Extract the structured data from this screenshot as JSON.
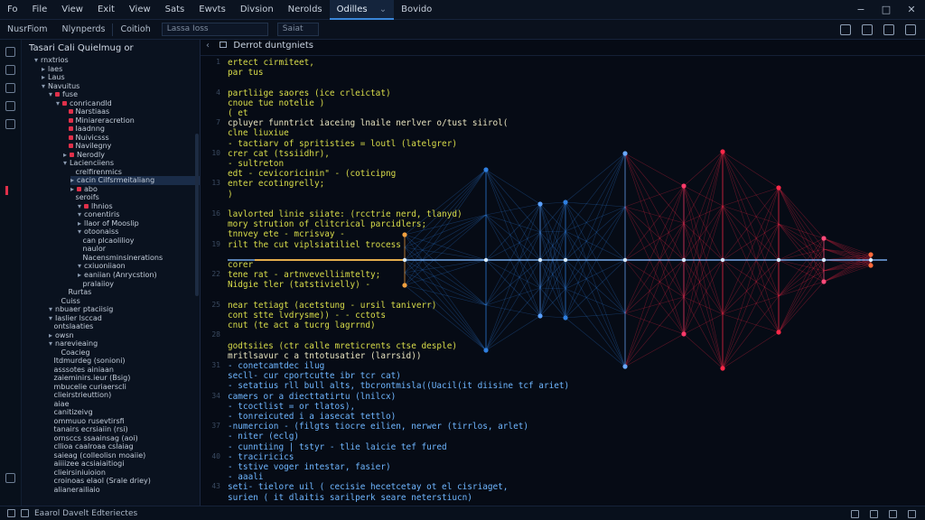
{
  "menubar": {
    "items": [
      "Fo",
      "File",
      "View",
      "Exit",
      "View",
      "Sats",
      "Ewvts",
      "Divsion",
      "Nerolds"
    ],
    "active_tab": "Odilles",
    "extra": "Bovido"
  },
  "toolbar": {
    "items": [
      "NusrFiom",
      "Nlynperds",
      "Coitioh"
    ],
    "field": "Lassa Ioss",
    "field2": "Saiat"
  },
  "sidebar": {
    "title": "Tasari Cali Quielmug or",
    "tree": [
      {
        "label": "rnxtrios",
        "indent": 0,
        "tw": "▾",
        "icon": ""
      },
      {
        "label": "laes",
        "indent": 1,
        "tw": "▸",
        "icon": ""
      },
      {
        "label": "Laus",
        "indent": 1,
        "tw": "▸",
        "icon": ""
      },
      {
        "label": "Navuitus",
        "indent": 1,
        "tw": "▾",
        "icon": ""
      },
      {
        "label": "fuse",
        "indent": 2,
        "tw": "▾",
        "icon": "#e0304a"
      },
      {
        "label": "conricandld",
        "indent": 3,
        "tw": "▾",
        "icon": "#e0304a"
      },
      {
        "label": "Narstiaas",
        "indent": 4,
        "tw": "",
        "icon": "#e0304a"
      },
      {
        "label": "Miniareracretion",
        "indent": 4,
        "tw": "",
        "icon": "#e0304a"
      },
      {
        "label": "Iaadnng",
        "indent": 4,
        "tw": "",
        "icon": "#e0304a"
      },
      {
        "label": "Nuivicsss",
        "indent": 4,
        "tw": "",
        "icon": "#e0304a"
      },
      {
        "label": "Navilegny",
        "indent": 4,
        "tw": "",
        "icon": "#e0304a"
      },
      {
        "label": "Nerodly",
        "indent": 4,
        "tw": "▸",
        "icon": "#e0304a"
      },
      {
        "label": "Lacienciiens",
        "indent": 4,
        "tw": "▾",
        "icon": ""
      },
      {
        "label": "crelfirenmics",
        "indent": 5,
        "tw": "",
        "icon": ""
      },
      {
        "label": "cacin Cilfsrmeitaliang",
        "indent": 5,
        "tw": "▸",
        "icon": "",
        "sel": true
      },
      {
        "label": "abo",
        "indent": 5,
        "tw": "▸",
        "icon": "#e0304a"
      },
      {
        "label": "seroifs",
        "indent": 5,
        "tw": "",
        "icon": ""
      },
      {
        "label": "lhnios",
        "indent": 6,
        "tw": "▾",
        "icon": "#e0304a"
      },
      {
        "label": "conentiris",
        "indent": 6,
        "tw": "▾",
        "icon": ""
      },
      {
        "label": "llaor of Mooslip",
        "indent": 6,
        "tw": "▸",
        "icon": ""
      },
      {
        "label": "otoonaiss",
        "indent": 6,
        "tw": "▾",
        "icon": ""
      },
      {
        "label": "can plcaolilioy",
        "indent": 6,
        "tw": "",
        "icon": ""
      },
      {
        "label": "naulor",
        "indent": 6,
        "tw": "",
        "icon": ""
      },
      {
        "label": "Nacensminsinerations",
        "indent": 6,
        "tw": "",
        "icon": ""
      },
      {
        "label": "cxiuoniiaon",
        "indent": 6,
        "tw": "▾",
        "icon": ""
      },
      {
        "label": "eaniian (Anrycstion)",
        "indent": 6,
        "tw": "▸",
        "icon": ""
      },
      {
        "label": "pralaiioy",
        "indent": 6,
        "tw": "",
        "icon": ""
      },
      {
        "label": "Rurtas",
        "indent": 4,
        "tw": "",
        "icon": ""
      },
      {
        "label": "Cuiss",
        "indent": 3,
        "tw": "",
        "icon": ""
      },
      {
        "label": "nbuaer ptaciisig",
        "indent": 2,
        "tw": "▾",
        "icon": ""
      },
      {
        "label": "Iaslier lsccad",
        "indent": 2,
        "tw": "▾",
        "icon": ""
      },
      {
        "label": "ontslaaties",
        "indent": 2,
        "tw": "",
        "icon": ""
      },
      {
        "label": "owsn",
        "indent": 2,
        "tw": "▸",
        "icon": ""
      },
      {
        "label": "narevieaing",
        "indent": 2,
        "tw": "▾",
        "icon": ""
      },
      {
        "label": "Coacieg",
        "indent": 3,
        "tw": "",
        "icon": ""
      },
      {
        "label": "Itdmurdeg (sonioni)",
        "indent": 2,
        "tw": "",
        "icon": ""
      },
      {
        "label": "asssotes ainiaan",
        "indent": 2,
        "tw": "",
        "icon": ""
      },
      {
        "label": "zaieminirs.ieur (Bsig)",
        "indent": 2,
        "tw": "",
        "icon": ""
      },
      {
        "label": "mbucelie curiaerscli",
        "indent": 2,
        "tw": "",
        "icon": ""
      },
      {
        "label": "clieirstrieuttion)",
        "indent": 2,
        "tw": "",
        "icon": ""
      },
      {
        "label": "aiae",
        "indent": 2,
        "tw": "",
        "icon": ""
      },
      {
        "label": "canitizeivg",
        "indent": 2,
        "tw": "",
        "icon": ""
      },
      {
        "label": "ommuuo rusevtirsfi",
        "indent": 2,
        "tw": "",
        "icon": ""
      },
      {
        "label": "tanairs ecrsiaiin (rsi)",
        "indent": 2,
        "tw": "",
        "icon": ""
      },
      {
        "label": "ornsccs ssaainsag (aoi)",
        "indent": 2,
        "tw": "",
        "icon": ""
      },
      {
        "label": "cllioa caalroaa cslaiag",
        "indent": 2,
        "tw": "",
        "icon": ""
      },
      {
        "label": "saieag (colleolisn moaiie)",
        "indent": 2,
        "tw": "",
        "icon": ""
      },
      {
        "label": "aiiiizee acsiaiaitiogi",
        "indent": 2,
        "tw": "",
        "icon": ""
      },
      {
        "label": "clieirsiniuioion",
        "indent": 2,
        "tw": "",
        "icon": ""
      },
      {
        "label": "croinoas elaol (Srale driey)",
        "indent": 2,
        "tw": "",
        "icon": ""
      },
      {
        "label": "alianerailiaio",
        "indent": 2,
        "tw": "",
        "icon": ""
      }
    ]
  },
  "editor": {
    "tab_label": "Derrot duntgniets",
    "lines": [
      {
        "text": "ertect cirmiteet,",
        "color": "#d9dd4a"
      },
      {
        "text": "par tus",
        "color": "#d9dd4a"
      },
      {
        "text": "",
        "color": "#d9dd4a"
      },
      {
        "text": "partliige saores (ice crleictat)",
        "color": "#d9dd4a"
      },
      {
        "text": "cnoue tue notelie )",
        "color": "#d9dd4a"
      },
      {
        "text": "  (   et              ",
        "color": "#d9dd4a"
      },
      {
        "text": "  cpluyer funntrict iaceing lnaile nerlver o/tust siirol(",
        "color": "#e8e4c0"
      },
      {
        "text": "  clne liuxiue",
        "color": "#d9dd4a"
      },
      {
        "text": "  - tactiarv of spritisties = loutl (latelgrer)",
        "color": "#d9dd4a"
      },
      {
        "text": "crer cat (tssiidhr),",
        "color": "#d9dd4a"
      },
      {
        "text": "- sultreton",
        "color": "#d9dd4a"
      },
      {
        "text": "  edt - cevicoricinin\" - (coticipng",
        "color": "#d9dd4a"
      },
      {
        "text": "  enter ecotingrelly;",
        "color": "#d9dd4a"
      },
      {
        "text": ")",
        "color": "#d9dd4a"
      },
      {
        "text": "",
        "color": "#d9dd4a"
      },
      {
        "text": "   lavlorted linie siiate: (rcctrie nerd, tlanyd)",
        "color": "#d9dd4a"
      },
      {
        "text": "   mory strution of clitcrical parcidlers;",
        "color": "#d9dd4a"
      },
      {
        "text": "   tnnvey ete - mcrisvay -",
        "color": "#d9dd4a"
      },
      {
        "text": "   rilt the cut viplsiatiliel trocess",
        "color": "#d9dd4a"
      },
      {
        "text": "",
        "color": "#d9dd4a"
      },
      {
        "text": "   corer",
        "color": "#d9dd4a"
      },
      {
        "text": "   tene rat - artnvevelliimtelty;",
        "color": "#d9dd4a"
      },
      {
        "text": "   Nidgie tler (tatstivielly) -",
        "color": "#d9dd4a"
      },
      {
        "text": "",
        "color": "#d9dd4a"
      },
      {
        "text": "   near tetiagt (acetstung - ursil taniverr)",
        "color": "#d9dd4a"
      },
      {
        "text": "   cont stte lvdrysme)) - - cctots",
        "color": "#d9dd4a"
      },
      {
        "text": "   cnut (te act a tucrg lagrrnd)",
        "color": "#d9dd4a"
      },
      {
        "text": "",
        "color": "#d9dd4a"
      },
      {
        "text": "   godtsiies (ctr calle mreticrents ctse desple)",
        "color": "#d9dd4a"
      },
      {
        "text": "   mritlsavur c a tntotusatier (larrsid))",
        "color": "#e8e4c0"
      },
      {
        "text": "  - conetcamtdec ilug",
        "color": "#6fb6ff"
      },
      {
        "text": "    secll- cur cportcutte ibr tcr cat)",
        "color": "#6fb6ff"
      },
      {
        "text": "  - setatius rll bull alts, tbcrontmisla((Uacil(it diisine tcf ariet)",
        "color": "#6fb6ff"
      },
      {
        "text": "   camers or a diecttatirtu (lnilcx)",
        "color": "#6fb6ff"
      },
      {
        "text": "  - tcoctlist = or tlatos),",
        "color": "#6fb6ff"
      },
      {
        "text": "  - tonreicuted i a iasecat tettlo)",
        "color": "#6fb6ff"
      },
      {
        "text": "    -numercion - (filgts tiocre eilien, nerwer (tirrlos, arlet)",
        "color": "#6fb6ff"
      },
      {
        "text": "  - niter (eclg)",
        "color": "#6fb6ff"
      },
      {
        "text": "  - cunntiing | tstyr - tlie laicie tef fured",
        "color": "#6fb6ff"
      },
      {
        "text": "  - traciricics",
        "color": "#6fb6ff"
      },
      {
        "text": "  - tstive voger intestar, fasier)",
        "color": "#6fb6ff"
      },
      {
        "text": "  - aaali",
        "color": "#6fb6ff"
      },
      {
        "text": "    seti- tielore uil ( cecisie hecetcetay ot el cisriaget,",
        "color": "#6fb6ff"
      },
      {
        "text": "    surien ( it dlaitis sarilperk seare neterstiucn)",
        "color": "#6fb6ff"
      }
    ]
  },
  "status": {
    "text": "Eaarol Davelt Edteriectes"
  },
  "colors": {
    "accent": "#3a86d8",
    "code_yellow": "#d9dd4a",
    "code_blue": "#6fb6ff",
    "marker_red": "#e0304a",
    "viz_blue": "#2f7fe0",
    "viz_red": "#ff2848"
  },
  "icons": [
    "search-icon",
    "bell-icon",
    "minimize-icon",
    "maximize-icon",
    "close-icon",
    "folder-icon",
    "explorer-icon",
    "git-icon",
    "debug-icon",
    "extensions-icon",
    "settings-icon",
    "chevron-icon"
  ]
}
